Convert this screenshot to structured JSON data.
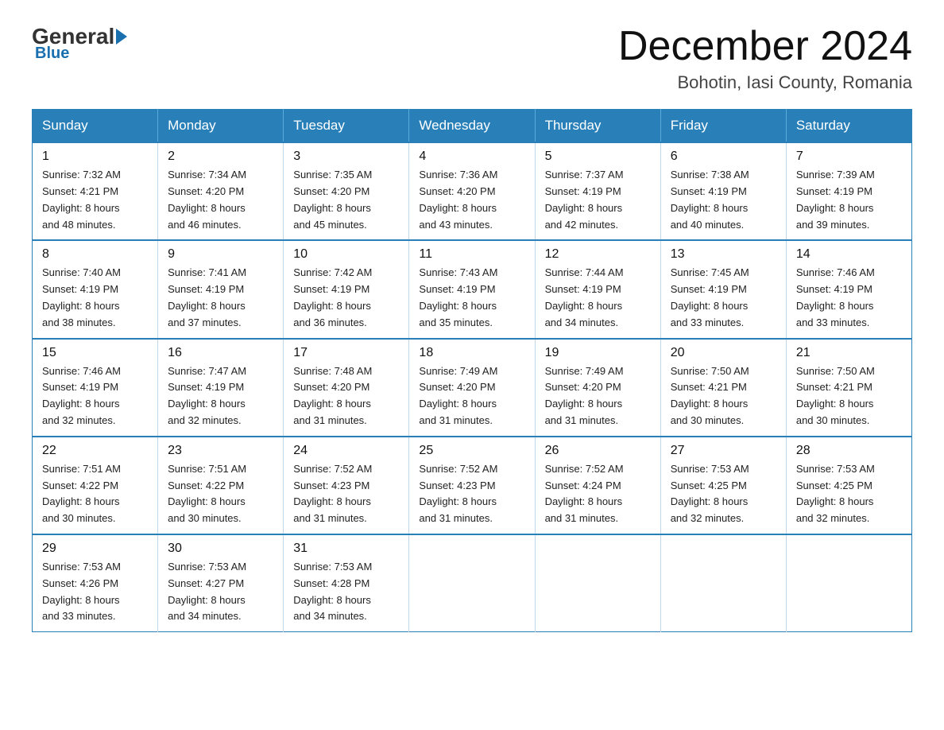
{
  "logo": {
    "general": "General",
    "blue": "Blue"
  },
  "header": {
    "month": "December 2024",
    "location": "Bohotin, Iasi County, Romania"
  },
  "weekdays": [
    "Sunday",
    "Monday",
    "Tuesday",
    "Wednesday",
    "Thursday",
    "Friday",
    "Saturday"
  ],
  "weeks": [
    [
      {
        "day": "1",
        "sunrise": "7:32 AM",
        "sunset": "4:21 PM",
        "daylight": "8 hours and 48 minutes."
      },
      {
        "day": "2",
        "sunrise": "7:34 AM",
        "sunset": "4:20 PM",
        "daylight": "8 hours and 46 minutes."
      },
      {
        "day": "3",
        "sunrise": "7:35 AM",
        "sunset": "4:20 PM",
        "daylight": "8 hours and 45 minutes."
      },
      {
        "day": "4",
        "sunrise": "7:36 AM",
        "sunset": "4:20 PM",
        "daylight": "8 hours and 43 minutes."
      },
      {
        "day": "5",
        "sunrise": "7:37 AM",
        "sunset": "4:19 PM",
        "daylight": "8 hours and 42 minutes."
      },
      {
        "day": "6",
        "sunrise": "7:38 AM",
        "sunset": "4:19 PM",
        "daylight": "8 hours and 40 minutes."
      },
      {
        "day": "7",
        "sunrise": "7:39 AM",
        "sunset": "4:19 PM",
        "daylight": "8 hours and 39 minutes."
      }
    ],
    [
      {
        "day": "8",
        "sunrise": "7:40 AM",
        "sunset": "4:19 PM",
        "daylight": "8 hours and 38 minutes."
      },
      {
        "day": "9",
        "sunrise": "7:41 AM",
        "sunset": "4:19 PM",
        "daylight": "8 hours and 37 minutes."
      },
      {
        "day": "10",
        "sunrise": "7:42 AM",
        "sunset": "4:19 PM",
        "daylight": "8 hours and 36 minutes."
      },
      {
        "day": "11",
        "sunrise": "7:43 AM",
        "sunset": "4:19 PM",
        "daylight": "8 hours and 35 minutes."
      },
      {
        "day": "12",
        "sunrise": "7:44 AM",
        "sunset": "4:19 PM",
        "daylight": "8 hours and 34 minutes."
      },
      {
        "day": "13",
        "sunrise": "7:45 AM",
        "sunset": "4:19 PM",
        "daylight": "8 hours and 33 minutes."
      },
      {
        "day": "14",
        "sunrise": "7:46 AM",
        "sunset": "4:19 PM",
        "daylight": "8 hours and 33 minutes."
      }
    ],
    [
      {
        "day": "15",
        "sunrise": "7:46 AM",
        "sunset": "4:19 PM",
        "daylight": "8 hours and 32 minutes."
      },
      {
        "day": "16",
        "sunrise": "7:47 AM",
        "sunset": "4:19 PM",
        "daylight": "8 hours and 32 minutes."
      },
      {
        "day": "17",
        "sunrise": "7:48 AM",
        "sunset": "4:20 PM",
        "daylight": "8 hours and 31 minutes."
      },
      {
        "day": "18",
        "sunrise": "7:49 AM",
        "sunset": "4:20 PM",
        "daylight": "8 hours and 31 minutes."
      },
      {
        "day": "19",
        "sunrise": "7:49 AM",
        "sunset": "4:20 PM",
        "daylight": "8 hours and 31 minutes."
      },
      {
        "day": "20",
        "sunrise": "7:50 AM",
        "sunset": "4:21 PM",
        "daylight": "8 hours and 30 minutes."
      },
      {
        "day": "21",
        "sunrise": "7:50 AM",
        "sunset": "4:21 PM",
        "daylight": "8 hours and 30 minutes."
      }
    ],
    [
      {
        "day": "22",
        "sunrise": "7:51 AM",
        "sunset": "4:22 PM",
        "daylight": "8 hours and 30 minutes."
      },
      {
        "day": "23",
        "sunrise": "7:51 AM",
        "sunset": "4:22 PM",
        "daylight": "8 hours and 30 minutes."
      },
      {
        "day": "24",
        "sunrise": "7:52 AM",
        "sunset": "4:23 PM",
        "daylight": "8 hours and 31 minutes."
      },
      {
        "day": "25",
        "sunrise": "7:52 AM",
        "sunset": "4:23 PM",
        "daylight": "8 hours and 31 minutes."
      },
      {
        "day": "26",
        "sunrise": "7:52 AM",
        "sunset": "4:24 PM",
        "daylight": "8 hours and 31 minutes."
      },
      {
        "day": "27",
        "sunrise": "7:53 AM",
        "sunset": "4:25 PM",
        "daylight": "8 hours and 32 minutes."
      },
      {
        "day": "28",
        "sunrise": "7:53 AM",
        "sunset": "4:25 PM",
        "daylight": "8 hours and 32 minutes."
      }
    ],
    [
      {
        "day": "29",
        "sunrise": "7:53 AM",
        "sunset": "4:26 PM",
        "daylight": "8 hours and 33 minutes."
      },
      {
        "day": "30",
        "sunrise": "7:53 AM",
        "sunset": "4:27 PM",
        "daylight": "8 hours and 34 minutes."
      },
      {
        "day": "31",
        "sunrise": "7:53 AM",
        "sunset": "4:28 PM",
        "daylight": "8 hours and 34 minutes."
      },
      null,
      null,
      null,
      null
    ]
  ],
  "labels": {
    "sunrise": "Sunrise:",
    "sunset": "Sunset:",
    "daylight": "Daylight:"
  }
}
